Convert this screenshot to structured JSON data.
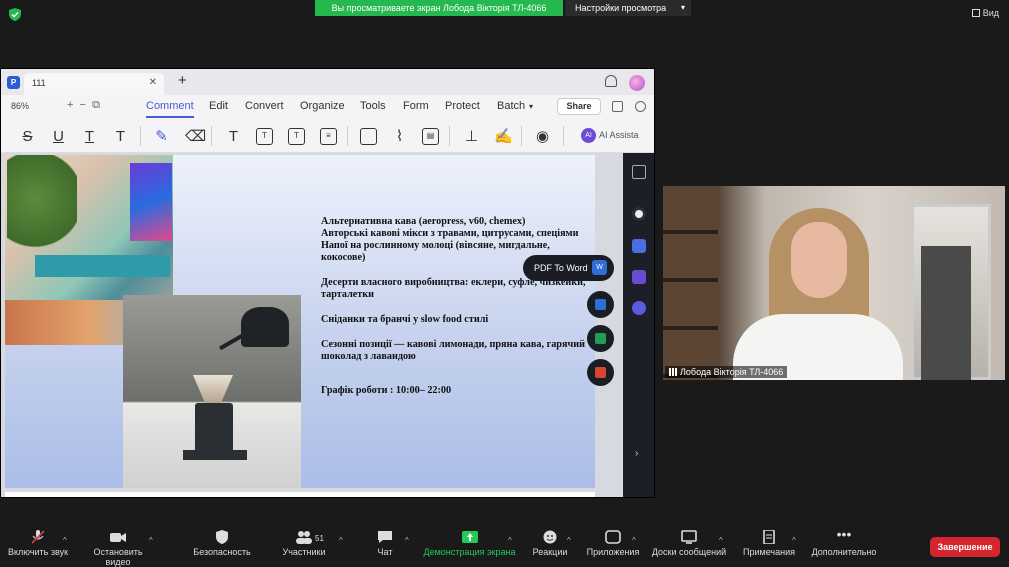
{
  "top": {
    "share_banner": "Вы просматриваете экран Лобода Вікторія ТЛ-4066",
    "view_settings": "Настройки просмотра",
    "view_button": "Вид"
  },
  "pdf_app": {
    "tab_title": "111",
    "zoom": "86%",
    "menu": [
      "Comment",
      "Edit",
      "Convert",
      "Organize",
      "Tools",
      "Form",
      "Protect",
      "Batch"
    ],
    "active_menu": "Comment",
    "share": "Share",
    "ai_label": "AI Assista",
    "fab_pdf_to_word": "PDF To Word",
    "slide_paragraphs": [
      "Альтернативна кава (aeropress, v60, chemex)\nАвторські кавові мікси з травами, цитрусами, спеціями\nНапої на рослинному молоці (вівсяне, мигдальне, кокосове)",
      "Десерти власного виробництва: еклери, суфле, чизкейки, тарталетки",
      "Сніданки та бранчі у slow food стилі",
      "Сезонні позиції — кавові лимонади, пряна кава, гарячий шоколад з лавандою"
    ],
    "schedule": "Графік роботи : 10:00– 22:00"
  },
  "participant": {
    "name": "Лобода Вікторія ТЛ-4066"
  },
  "bottom": {
    "mic": "Включить звук",
    "video": "Остановить видео",
    "security": "Безопасность",
    "participants": "Участники",
    "participants_count": "51",
    "chat": "Чат",
    "share_screen": "Демонстрация экрана",
    "reactions": "Реакции",
    "apps": "Приложения",
    "whiteboards": "Доски сообщений",
    "notes": "Примечания",
    "more": "Дополнительно",
    "end": "Завершение"
  },
  "colors": {
    "share_green": "#24b84f",
    "end_red": "#d5262f",
    "accent_blue": "#4a5bd6"
  }
}
